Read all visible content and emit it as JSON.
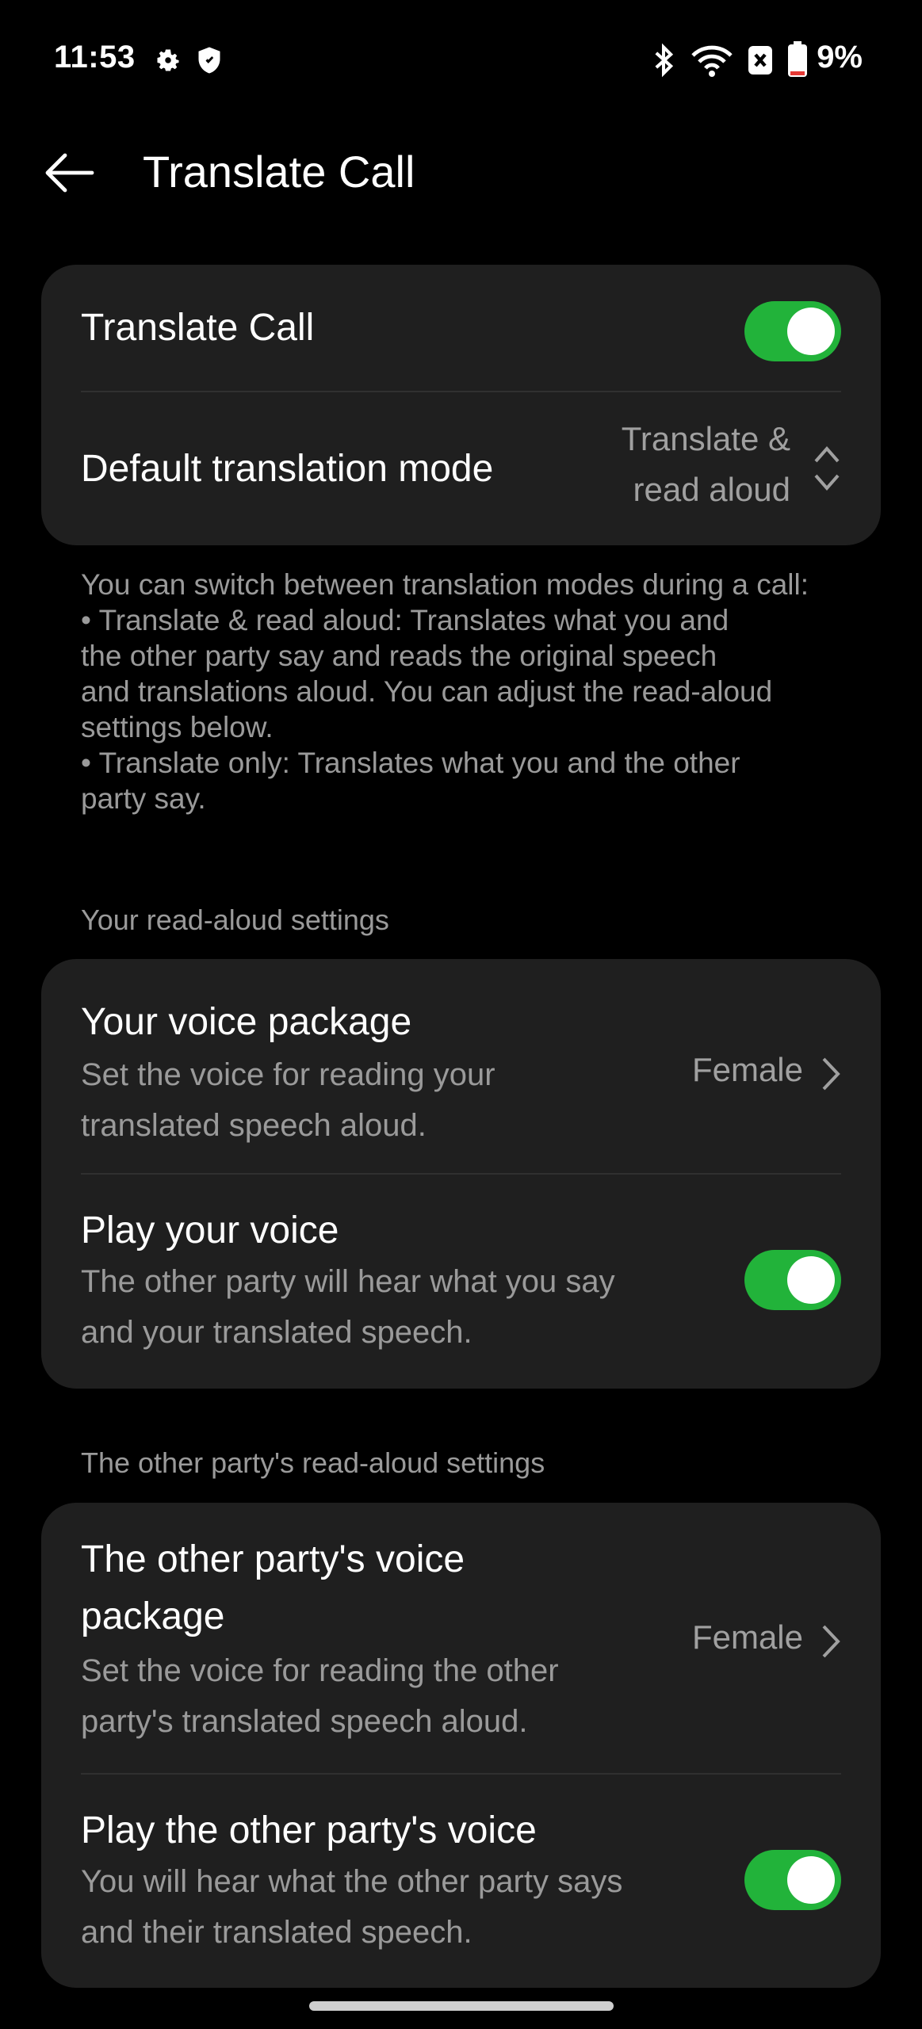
{
  "status_bar": {
    "time": "11:53",
    "battery_percent": "9%",
    "icons": [
      "settings-icon",
      "shield-icon",
      "bluetooth-icon",
      "wifi-icon",
      "sim-off-icon",
      "battery-icon"
    ]
  },
  "header": {
    "title": "Translate Call"
  },
  "main_card": {
    "translate_call": {
      "label": "Translate Call",
      "enabled": true
    },
    "default_mode": {
      "label": "Default translation mode",
      "value_line1": "Translate &",
      "value_line2": "read aloud"
    }
  },
  "note": {
    "line1": "You can switch between translation modes during a call:",
    "line2": "• Translate & read aloud: Translates what you and",
    "line3": "the other party say and reads the original speech",
    "line4": "and translations aloud. You can adjust the read-aloud",
    "line5": "settings below.",
    "line6": "• Translate only: Translates what you and the other",
    "line7": "party say."
  },
  "your_settings": {
    "section_label": "Your read-aloud settings",
    "voice_package": {
      "title": "Your voice package",
      "sub_line1": "Set the voice for reading your",
      "sub_line2": "translated speech aloud.",
      "value": "Female"
    },
    "play_voice": {
      "title": "Play your voice",
      "sub_line1": "The other party will hear what you say",
      "sub_line2": "and your translated speech.",
      "enabled": true
    }
  },
  "other_settings": {
    "section_label": "The other party's read-aloud settings",
    "voice_package": {
      "title_line1": "The other party's voice",
      "title_line2": "package",
      "sub_line1": "Set the voice for reading the other",
      "sub_line2": "party's translated speech aloud.",
      "value": "Female"
    },
    "play_voice": {
      "title": "Play the other party's voice",
      "sub_line1": "You will hear what the other party says",
      "sub_line2": "and their translated speech.",
      "enabled": true
    }
  },
  "colors": {
    "accent_green": "#22b33a",
    "card_bg": "#1f1f1f",
    "secondary_text": "#9a9a9a",
    "battery_low": "#e53935"
  }
}
